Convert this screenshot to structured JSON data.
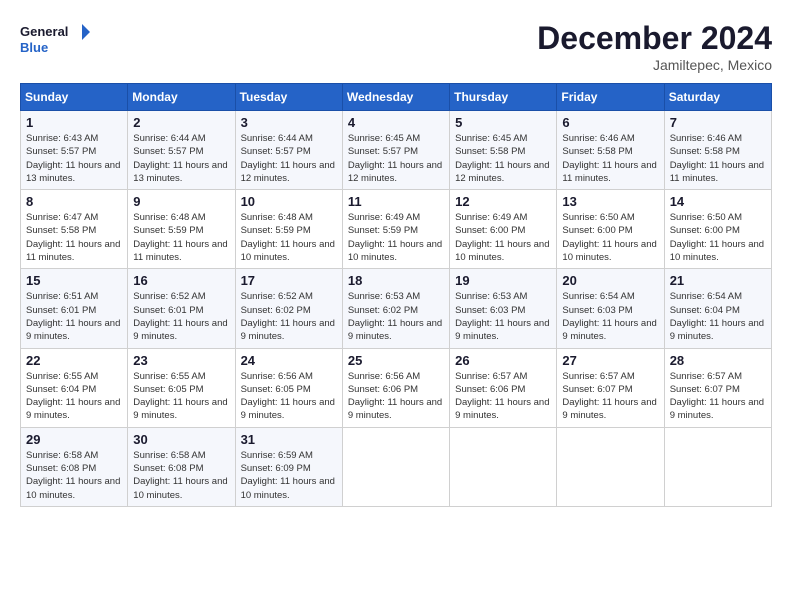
{
  "header": {
    "logo_line1": "General",
    "logo_line2": "Blue",
    "month": "December 2024",
    "location": "Jamiltepec, Mexico"
  },
  "weekdays": [
    "Sunday",
    "Monday",
    "Tuesday",
    "Wednesday",
    "Thursday",
    "Friday",
    "Saturday"
  ],
  "weeks": [
    [
      {
        "day": "1",
        "sunrise": "6:43 AM",
        "sunset": "5:57 PM",
        "daylight": "11 hours and 13 minutes."
      },
      {
        "day": "2",
        "sunrise": "6:44 AM",
        "sunset": "5:57 PM",
        "daylight": "11 hours and 13 minutes."
      },
      {
        "day": "3",
        "sunrise": "6:44 AM",
        "sunset": "5:57 PM",
        "daylight": "11 hours and 12 minutes."
      },
      {
        "day": "4",
        "sunrise": "6:45 AM",
        "sunset": "5:57 PM",
        "daylight": "11 hours and 12 minutes."
      },
      {
        "day": "5",
        "sunrise": "6:45 AM",
        "sunset": "5:58 PM",
        "daylight": "11 hours and 12 minutes."
      },
      {
        "day": "6",
        "sunrise": "6:46 AM",
        "sunset": "5:58 PM",
        "daylight": "11 hours and 11 minutes."
      },
      {
        "day": "7",
        "sunrise": "6:46 AM",
        "sunset": "5:58 PM",
        "daylight": "11 hours and 11 minutes."
      }
    ],
    [
      {
        "day": "8",
        "sunrise": "6:47 AM",
        "sunset": "5:58 PM",
        "daylight": "11 hours and 11 minutes."
      },
      {
        "day": "9",
        "sunrise": "6:48 AM",
        "sunset": "5:59 PM",
        "daylight": "11 hours and 11 minutes."
      },
      {
        "day": "10",
        "sunrise": "6:48 AM",
        "sunset": "5:59 PM",
        "daylight": "11 hours and 10 minutes."
      },
      {
        "day": "11",
        "sunrise": "6:49 AM",
        "sunset": "5:59 PM",
        "daylight": "11 hours and 10 minutes."
      },
      {
        "day": "12",
        "sunrise": "6:49 AM",
        "sunset": "6:00 PM",
        "daylight": "11 hours and 10 minutes."
      },
      {
        "day": "13",
        "sunrise": "6:50 AM",
        "sunset": "6:00 PM",
        "daylight": "11 hours and 10 minutes."
      },
      {
        "day": "14",
        "sunrise": "6:50 AM",
        "sunset": "6:00 PM",
        "daylight": "11 hours and 10 minutes."
      }
    ],
    [
      {
        "day": "15",
        "sunrise": "6:51 AM",
        "sunset": "6:01 PM",
        "daylight": "11 hours and 9 minutes."
      },
      {
        "day": "16",
        "sunrise": "6:52 AM",
        "sunset": "6:01 PM",
        "daylight": "11 hours and 9 minutes."
      },
      {
        "day": "17",
        "sunrise": "6:52 AM",
        "sunset": "6:02 PM",
        "daylight": "11 hours and 9 minutes."
      },
      {
        "day": "18",
        "sunrise": "6:53 AM",
        "sunset": "6:02 PM",
        "daylight": "11 hours and 9 minutes."
      },
      {
        "day": "19",
        "sunrise": "6:53 AM",
        "sunset": "6:03 PM",
        "daylight": "11 hours and 9 minutes."
      },
      {
        "day": "20",
        "sunrise": "6:54 AM",
        "sunset": "6:03 PM",
        "daylight": "11 hours and 9 minutes."
      },
      {
        "day": "21",
        "sunrise": "6:54 AM",
        "sunset": "6:04 PM",
        "daylight": "11 hours and 9 minutes."
      }
    ],
    [
      {
        "day": "22",
        "sunrise": "6:55 AM",
        "sunset": "6:04 PM",
        "daylight": "11 hours and 9 minutes."
      },
      {
        "day": "23",
        "sunrise": "6:55 AM",
        "sunset": "6:05 PM",
        "daylight": "11 hours and 9 minutes."
      },
      {
        "day": "24",
        "sunrise": "6:56 AM",
        "sunset": "6:05 PM",
        "daylight": "11 hours and 9 minutes."
      },
      {
        "day": "25",
        "sunrise": "6:56 AM",
        "sunset": "6:06 PM",
        "daylight": "11 hours and 9 minutes."
      },
      {
        "day": "26",
        "sunrise": "6:57 AM",
        "sunset": "6:06 PM",
        "daylight": "11 hours and 9 minutes."
      },
      {
        "day": "27",
        "sunrise": "6:57 AM",
        "sunset": "6:07 PM",
        "daylight": "11 hours and 9 minutes."
      },
      {
        "day": "28",
        "sunrise": "6:57 AM",
        "sunset": "6:07 PM",
        "daylight": "11 hours and 9 minutes."
      }
    ],
    [
      {
        "day": "29",
        "sunrise": "6:58 AM",
        "sunset": "6:08 PM",
        "daylight": "11 hours and 10 minutes."
      },
      {
        "day": "30",
        "sunrise": "6:58 AM",
        "sunset": "6:08 PM",
        "daylight": "11 hours and 10 minutes."
      },
      {
        "day": "31",
        "sunrise": "6:59 AM",
        "sunset": "6:09 PM",
        "daylight": "11 hours and 10 minutes."
      },
      null,
      null,
      null,
      null
    ]
  ]
}
